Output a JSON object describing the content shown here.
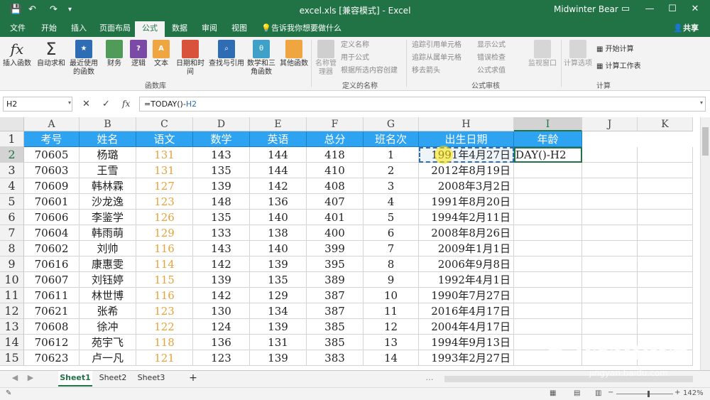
{
  "titlebar": {
    "title": "excel.xls  [兼容模式]  -  Excel",
    "user": "Midwinter Bear",
    "save_icon": "💾",
    "undo_icon": "↶",
    "redo_icon": "↷",
    "customize_icon": "▾",
    "minimize": "—",
    "maximize": "☐",
    "close": "✕",
    "restore": "▭"
  },
  "tabs": {
    "items": [
      "文件",
      "开始",
      "插入",
      "页面布局",
      "公式",
      "数据",
      "审阅",
      "视图"
    ],
    "active": "公式",
    "tell_me": "告诉我你想要做什么",
    "share": "共享"
  },
  "ribbon": {
    "library": {
      "insert_function": "插入函数",
      "autosum": "自动求和",
      "recent": "最近使用的函数",
      "financial": "财务",
      "logical": "逻辑",
      "text": "文本",
      "datetime": "日期和时间",
      "lookup": "查找与引用",
      "math": "数学和三角函数",
      "other": "其他函数",
      "group_label": "函数库"
    },
    "names": {
      "name_manager": "名称管理器",
      "define_name": "定义名称",
      "use_in_formula": "用于公式",
      "create_from_selection": "根据所选内容创建",
      "group_label": "定义的名称"
    },
    "audit": {
      "trace_precedents": "追踪引用单元格",
      "trace_dependents": "追踪从属单元格",
      "remove_arrows": "移去箭头",
      "show_formulas": "显示公式",
      "error_checking": "错误检查",
      "evaluate_formula": "公式求值",
      "watch_window": "监视窗口",
      "group_label": "公式审核"
    },
    "calc": {
      "options": "计算选项",
      "calc_now": "开始计算",
      "calc_sheet": "计算工作表",
      "group_label": "计算"
    }
  },
  "formula_bar": {
    "name_box": "H2",
    "cancel": "✕",
    "enter": "✓",
    "fx": "fx",
    "formula_prefix": "=TODAY()-",
    "formula_ref": "H2"
  },
  "columns": [
    "A",
    "B",
    "C",
    "D",
    "E",
    "F",
    "G",
    "H",
    "I",
    "J",
    "K"
  ],
  "rows": [
    "1",
    "2",
    "3",
    "4",
    "5",
    "6",
    "7",
    "8",
    "9",
    "10",
    "11",
    "12",
    "13",
    "14",
    "15"
  ],
  "table": {
    "headers": [
      "考号",
      "姓名",
      "语文",
      "数学",
      "英语",
      "总分",
      "班名次",
      "出生日期",
      "年龄"
    ],
    "rows": [
      [
        "70605",
        "杨璐",
        "131",
        "143",
        "144",
        "418",
        "1",
        "1991年4月27日"
      ],
      [
        "70603",
        "王雪",
        "131",
        "135",
        "144",
        "410",
        "2",
        "2012年8月19日"
      ],
      [
        "70609",
        "韩林霖",
        "127",
        "139",
        "142",
        "408",
        "3",
        "2008年3月2日"
      ],
      [
        "70601",
        "沙龙逸",
        "123",
        "148",
        "136",
        "407",
        "4",
        "1991年8月20日"
      ],
      [
        "70606",
        "李鉴学",
        "126",
        "135",
        "140",
        "401",
        "5",
        "1994年2月11日"
      ],
      [
        "70604",
        "韩雨萌",
        "129",
        "133",
        "138",
        "400",
        "6",
        "2008年8月26日"
      ],
      [
        "70602",
        "刘帅",
        "116",
        "143",
        "140",
        "399",
        "7",
        "2009年1月1日"
      ],
      [
        "70616",
        "康惠雯",
        "114",
        "142",
        "139",
        "395",
        "8",
        "2006年9月8日"
      ],
      [
        "70607",
        "刘钰婷",
        "115",
        "139",
        "135",
        "389",
        "9",
        "1992年4月1日"
      ],
      [
        "70611",
        "林世博",
        "116",
        "142",
        "129",
        "387",
        "10",
        "1990年7月27日"
      ],
      [
        "70621",
        "张希",
        "123",
        "130",
        "134",
        "387",
        "11",
        "2016年4月17日"
      ],
      [
        "70608",
        "徐冲",
        "122",
        "124",
        "139",
        "385",
        "12",
        "2004年4月17日"
      ],
      [
        "70612",
        "苑宇飞",
        "118",
        "136",
        "131",
        "385",
        "13",
        "1994年9月13日"
      ],
      [
        "70623",
        "卢一凡",
        "121",
        "123",
        "139",
        "383",
        "14",
        "1993年2月27日"
      ]
    ],
    "editing_cell_text": "DAY()-H2"
  },
  "sheets": {
    "tabs": [
      "Sheet1",
      "Sheet2",
      "Sheet3"
    ],
    "active": "Sheet1",
    "add": "+",
    "nav_prev": "◀",
    "nav_next": "▶",
    "more": "…"
  },
  "status": {
    "mode_icon": "✎",
    "zoom": "142%",
    "zoom_minus": "−",
    "zoom_plus": "+"
  },
  "watermark": {
    "brand": "Bai",
    "brand2": "du",
    "cn": "经验",
    "url": "jingyan.baidu.com"
  },
  "colors": {
    "excel_green": "#217346",
    "header_fill": "#2ea3f2",
    "orange_text": "#e8a23a"
  }
}
